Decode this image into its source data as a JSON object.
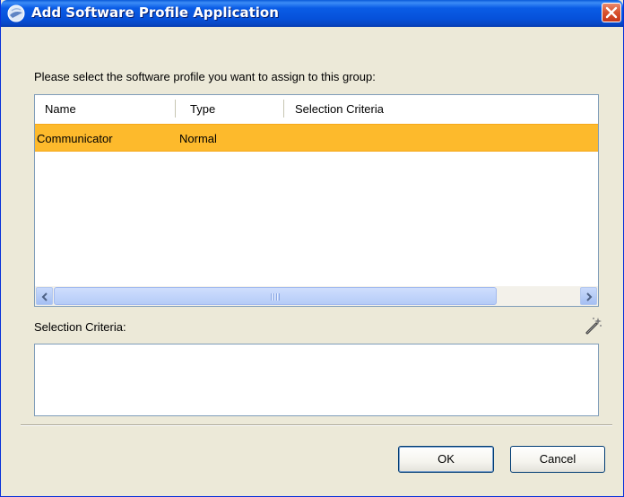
{
  "window": {
    "title": "Add Software Profile Application",
    "colors": {
      "titlebar": "#0651da",
      "face": "#ece9d8",
      "close": "#d8522e",
      "selection": "#fdba2c"
    }
  },
  "prompt": "Please select the software profile you want to assign to this group:",
  "table": {
    "columns": [
      "Name",
      "Type",
      "Selection Criteria"
    ],
    "rows": [
      {
        "name": "Communicator",
        "type": "Normal",
        "criteria": "",
        "selected": true
      }
    ]
  },
  "selection_criteria_label": "Selection Criteria:",
  "selection_criteria_value": "",
  "icons": {
    "app": "globe-icon",
    "close": "close-icon",
    "scroll_left": "arrow-left-icon",
    "scroll_right": "arrow-right-icon",
    "edit_criteria": "wand-icon"
  },
  "buttons": {
    "ok": "OK",
    "cancel": "Cancel"
  }
}
